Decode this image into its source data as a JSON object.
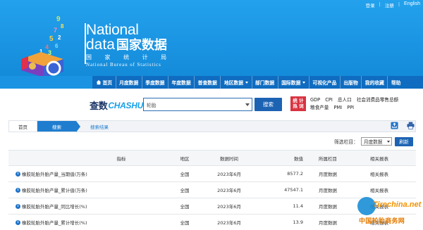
{
  "top_links": {
    "login": "登录",
    "register": "注册",
    "english": "English",
    "sep": "|"
  },
  "logo": {
    "national": "National",
    "data": "data",
    "cn_title": "国家数据",
    "sub": "国 家 统 计 局",
    "en": "National Bureau of Statistics"
  },
  "nav": {
    "items": [
      {
        "label": "首页",
        "dropdown": false,
        "icon": "home-icon"
      },
      {
        "label": "月度数据",
        "dropdown": false
      },
      {
        "label": "季度数据",
        "dropdown": false
      },
      {
        "label": "年度数据",
        "dropdown": false
      },
      {
        "label": "普查数据",
        "dropdown": false
      },
      {
        "label": "地区数据",
        "dropdown": true
      },
      {
        "label": "部门数据",
        "dropdown": false
      },
      {
        "label": "国际数据",
        "dropdown": true
      },
      {
        "label": "可视化产品",
        "dropdown": false
      },
      {
        "label": "出版物",
        "dropdown": false
      },
      {
        "label": "我的收藏",
        "dropdown": false
      },
      {
        "label": "帮助",
        "dropdown": false
      }
    ]
  },
  "search": {
    "brand_cn": "查数",
    "brand_en": "CHASHU",
    "value": "轮胎",
    "button": "搜索"
  },
  "hot": {
    "badge_line1": "统 计",
    "badge_line2": "热 词",
    "line1": [
      "GDP",
      "CPI",
      "总人口",
      "社会消费品零售总额"
    ],
    "line2": [
      "粮食产量",
      "PMI",
      "PPI"
    ]
  },
  "breadcrumb": {
    "home": "首页",
    "search": "搜索",
    "result": "搜索结果"
  },
  "filter": {
    "label": "筛选栏目：",
    "selected": "月度数据",
    "refresh": "刷新"
  },
  "table": {
    "headers": [
      "指标",
      "地区",
      "数据时间",
      "数值",
      "所属栏目",
      "相关报表"
    ],
    "rows": [
      {
        "indicator": "橡胶轮胎外胎产量_当期值(万条)",
        "region": "全国",
        "time": "2023年6月",
        "value": "8577.2",
        "column": "月度数据",
        "report": "相关报表"
      },
      {
        "indicator": "橡胶轮胎外胎产量_累计值(万条)",
        "region": "全国",
        "time": "2023年6月",
        "value": "47547.1",
        "column": "月度数据",
        "report": "相关报表"
      },
      {
        "indicator": "橡胶轮胎外胎产量_同比增长(%)",
        "region": "全国",
        "time": "2023年6月",
        "value": "11.4",
        "column": "月度数据",
        "report": "相关报表"
      },
      {
        "indicator": "橡胶轮胎外胎产量_累计增长(%)",
        "region": "全国",
        "time": "2023年6月",
        "value": "13.9",
        "column": "月度数据",
        "report": "相关报表"
      }
    ]
  },
  "watermark": {
    "en": "Tirechina.net",
    "cn": "中国轮胎商务网"
  },
  "colors": {
    "header": "#1a97e6",
    "nav": "#0f6cc0",
    "button": "#1d63b3",
    "hot_badge": "#d93340",
    "watermark": "#e57a00"
  }
}
